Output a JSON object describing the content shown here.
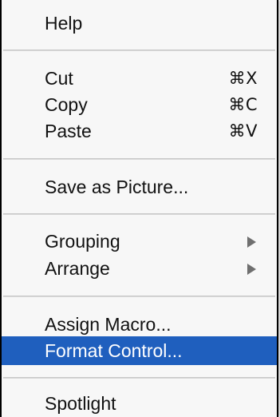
{
  "menu": {
    "items": [
      {
        "label": "Help"
      },
      {
        "label": "Cut",
        "shortcut": "⌘X"
      },
      {
        "label": "Copy",
        "shortcut": "⌘C"
      },
      {
        "label": "Paste",
        "shortcut": "⌘V"
      },
      {
        "label": "Save as Picture..."
      },
      {
        "label": "Grouping",
        "submenu_icon": "submenu-arrow-icon"
      },
      {
        "label": "Arrange",
        "submenu_icon": "submenu-arrow-icon"
      },
      {
        "label": "Assign Macro..."
      },
      {
        "label": "Format Control...",
        "highlighted": true
      },
      {
        "label": "Spotlight"
      }
    ],
    "colors": {
      "highlight": "#1f5fbe",
      "text": "#111111",
      "highlight_text": "#ffffff",
      "background": "#f7f7f7"
    }
  }
}
